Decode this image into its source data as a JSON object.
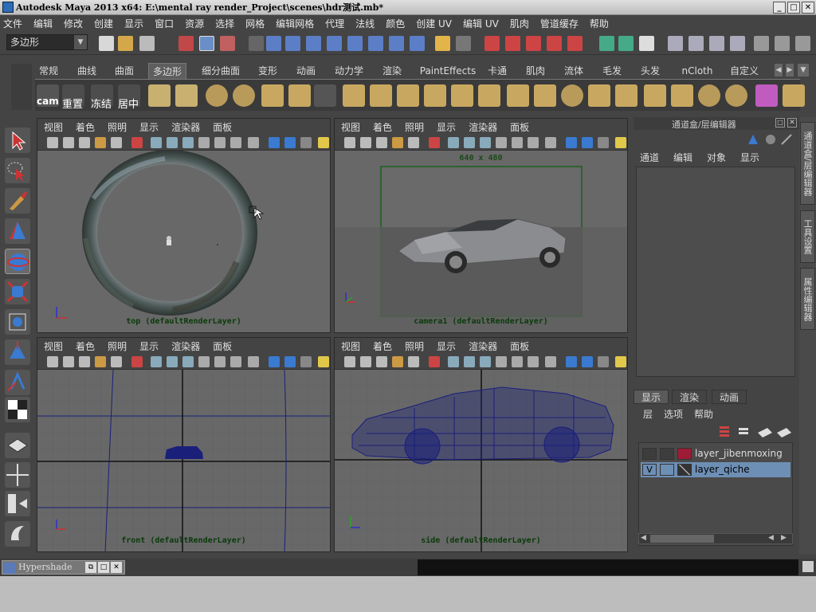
{
  "window": {
    "title": "Autodesk Maya 2013 x64: E:\\mental ray render_Project\\scenes\\hdr测试.mb*"
  },
  "menu": [
    "文件",
    "编辑",
    "修改",
    "创建",
    "显示",
    "窗口",
    "资源",
    "选择",
    "网格",
    "编辑网格",
    "代理",
    "法线",
    "颜色",
    "创建 UV",
    "编辑 UV",
    "肌肉",
    "管道缓存",
    "帮助"
  ],
  "status_line": {
    "mode_combo": "多边形"
  },
  "shelf_tabs": [
    {
      "label": "常规"
    },
    {
      "label": "曲线"
    },
    {
      "label": "曲面"
    },
    {
      "label": "多边形",
      "active": true
    },
    {
      "label": "细分曲面"
    },
    {
      "label": "变形"
    },
    {
      "label": "动画"
    },
    {
      "label": "动力学"
    },
    {
      "label": "渲染"
    },
    {
      "label": "PaintEffects"
    },
    {
      "label": "卡通"
    },
    {
      "label": "肌肉"
    },
    {
      "label": "流体"
    },
    {
      "label": "毛发"
    },
    {
      "label": "头发"
    },
    {
      "label": "nCloth"
    },
    {
      "label": "自定义"
    }
  ],
  "shelf_labels": {
    "cam": "cam",
    "reset": "重置",
    "freeze": "冻结",
    "center": "居中"
  },
  "viewport_menu": [
    "视图",
    "着色",
    "照明",
    "显示",
    "渲染器",
    "面板"
  ],
  "viewports": {
    "top": {
      "label": "top (defaultRenderLayer)"
    },
    "camera": {
      "label": "camera1 (defaultRenderLayer)",
      "resolution": "640 x 480"
    },
    "front": {
      "label": "front (defaultRenderLayer)"
    },
    "side": {
      "label": "side (defaultRenderLayer)"
    }
  },
  "channel_box": {
    "title": "通道盒/层编辑器",
    "menu": [
      "通道",
      "编辑",
      "对象",
      "显示"
    ]
  },
  "layer_editor": {
    "tabs": [
      "显示",
      "渲染",
      "动画"
    ],
    "menu": [
      "层",
      "选项",
      "帮助"
    ],
    "layers": [
      {
        "name": "layer_jibenmoxing",
        "visible": "",
        "color": "#9e1c35"
      },
      {
        "name": "layer_qiche",
        "visible": "V",
        "selected": true
      }
    ]
  },
  "side_tabs": [
    "通道盒/层编辑器",
    "工具设置",
    "属性编辑器"
  ],
  "taskbar": {
    "hypershade": "Hypershade"
  },
  "colors": {
    "bg": "#444444",
    "viewport": "#686868",
    "wireframe": "#1a1f7a",
    "selected_layer": "#6e8fb5"
  }
}
